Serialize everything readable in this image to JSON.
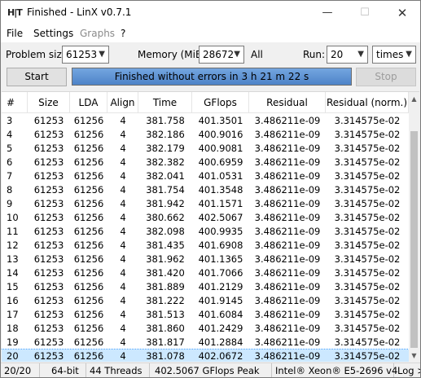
{
  "window": {
    "title": "Finished - LinX v0.7.1",
    "icon_text": "H|T",
    "minimize": "—",
    "maximize": "☐",
    "close": "✕"
  },
  "menu": {
    "file": "File",
    "settings": "Settings",
    "graphs": "Graphs",
    "help": "?"
  },
  "controls": {
    "problem_size_label": "Problem size:",
    "problem_size_value": "61253",
    "memory_label": "Memory (MiB):",
    "memory_value": "28672",
    "memory_all": "All",
    "run_label": "Run:",
    "run_value": "20",
    "run_unit": "times",
    "start_button": "Start",
    "stop_button": "Stop",
    "progress_text": "Finished without errors in 3 h 21 m 22 s",
    "progress_fraction": 1.0
  },
  "table": {
    "headers": [
      "#",
      "Size",
      "LDA",
      "Align",
      "Time",
      "GFlops",
      "Residual",
      "Residual (norm.)"
    ],
    "rows": [
      [
        "3",
        "61253",
        "61256",
        "4",
        "381.758",
        "401.3501",
        "3.486211e-09",
        "3.314575e-02"
      ],
      [
        "4",
        "61253",
        "61256",
        "4",
        "382.186",
        "400.9016",
        "3.486211e-09",
        "3.314575e-02"
      ],
      [
        "5",
        "61253",
        "61256",
        "4",
        "382.179",
        "400.9081",
        "3.486211e-09",
        "3.314575e-02"
      ],
      [
        "6",
        "61253",
        "61256",
        "4",
        "382.382",
        "400.6959",
        "3.486211e-09",
        "3.314575e-02"
      ],
      [
        "7",
        "61253",
        "61256",
        "4",
        "382.041",
        "401.0531",
        "3.486211e-09",
        "3.314575e-02"
      ],
      [
        "8",
        "61253",
        "61256",
        "4",
        "381.754",
        "401.3548",
        "3.486211e-09",
        "3.314575e-02"
      ],
      [
        "9",
        "61253",
        "61256",
        "4",
        "381.942",
        "401.1571",
        "3.486211e-09",
        "3.314575e-02"
      ],
      [
        "10",
        "61253",
        "61256",
        "4",
        "380.662",
        "402.5067",
        "3.486211e-09",
        "3.314575e-02"
      ],
      [
        "11",
        "61253",
        "61256",
        "4",
        "382.098",
        "400.9935",
        "3.486211e-09",
        "3.314575e-02"
      ],
      [
        "12",
        "61253",
        "61256",
        "4",
        "381.435",
        "401.6908",
        "3.486211e-09",
        "3.314575e-02"
      ],
      [
        "13",
        "61253",
        "61256",
        "4",
        "381.962",
        "401.1365",
        "3.486211e-09",
        "3.314575e-02"
      ],
      [
        "14",
        "61253",
        "61256",
        "4",
        "381.420",
        "401.7066",
        "3.486211e-09",
        "3.314575e-02"
      ],
      [
        "15",
        "61253",
        "61256",
        "4",
        "381.889",
        "401.2129",
        "3.486211e-09",
        "3.314575e-02"
      ],
      [
        "16",
        "61253",
        "61256",
        "4",
        "381.222",
        "401.9145",
        "3.486211e-09",
        "3.314575e-02"
      ],
      [
        "17",
        "61253",
        "61256",
        "4",
        "381.513",
        "401.6084",
        "3.486211e-09",
        "3.314575e-02"
      ],
      [
        "18",
        "61253",
        "61256",
        "4",
        "381.860",
        "401.2429",
        "3.486211e-09",
        "3.314575e-02"
      ],
      [
        "19",
        "61253",
        "61256",
        "4",
        "381.817",
        "401.2884",
        "3.486211e-09",
        "3.314575e-02"
      ],
      [
        "20",
        "61253",
        "61256",
        "4",
        "381.078",
        "402.0672",
        "3.486211e-09",
        "3.314575e-02"
      ]
    ],
    "selected_row": "20"
  },
  "status": {
    "progress": "20/20",
    "arch": "64-bit",
    "threads": "44 Threads",
    "peak": "402.5067 GFlops Peak",
    "cpu": "Intel® Xeon® E5-2696 v4",
    "log_button": "Log >"
  },
  "colors": {
    "progress_fill": "#5a8fd0",
    "selected_row": "#cce8ff"
  },
  "icons": [
    "app-icon",
    "minimize-icon",
    "maximize-icon",
    "close-icon",
    "chevron-down-icon",
    "scroll-up-icon",
    "scroll-down-icon"
  ]
}
